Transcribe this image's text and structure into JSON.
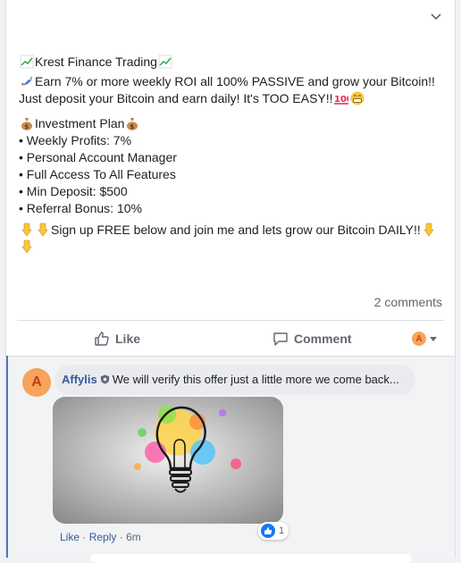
{
  "post": {
    "title_line": "Krest Finance Trading",
    "line1": "Earn 7% or more weekly ROI all 100% PASSIVE and grow your Bitcoin!! Just deposit your Bitcoin and earn daily! It's TOO EASY!!",
    "plan_title": "Investment Plan",
    "bullets": [
      "• Weekly Profits: 7%",
      "• Personal Account Manager",
      "• Full Access To All Features",
      "• Min Deposit: $500",
      "• Referral Bonus: 10%"
    ],
    "cta": "Sign up FREE below and join me and lets grow our Bitcoin DAILY!!",
    "comments_count": "2 comments"
  },
  "actions": {
    "like_label": "Like",
    "comment_label": "Comment",
    "avatar_letter": "A"
  },
  "comment": {
    "avatar_letter": "A",
    "author": "Affylis",
    "text": "We will verify this offer just a little more we come back...",
    "reaction_count": "1",
    "like_label": "Like",
    "reply_label": "Reply",
    "time": "6m"
  },
  "colors": {
    "accent": "#385898",
    "avatar": "#f7a35b",
    "like_blue": "#1877f2"
  }
}
